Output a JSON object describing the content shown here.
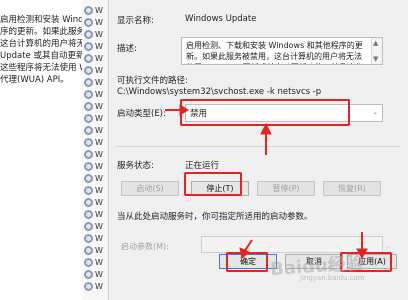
{
  "left_desc": {
    "lines": [
      "启用检测和安装 Windows 和",
      "序的更新。如果此服务被禁",
      "这台计算机的用户将无法使用",
      "Update 或其自动更新功能，",
      "这些程序将无法使用 Windows",
      "代理(WUA) API。"
    ]
  },
  "services_list": {
    "rows": [
      "W",
      "W",
      "W",
      "W",
      "W",
      "W",
      "W",
      "W",
      "W",
      "W",
      "W",
      "W",
      "W",
      "W",
      "W",
      "W",
      "W",
      "W",
      "W",
      "W",
      "W",
      "W",
      "W",
      "W"
    ]
  },
  "dialog": {
    "display_name_label": "显示名称:",
    "display_name_value": "Windows Update",
    "description_label": "描述:",
    "description_text": "启用检测、下载和安装 Windows 和其他程序的更新。如果此服务被禁用，这台计算机的用户将无法使用 Windows 更新或其自动更新功能，并且这些程序将无法",
    "exec_path_label": "可执行文件的路径:",
    "exec_path_value": "C:\\Windows\\system32\\svchost.exe -k netsvcs -p",
    "startup_type_label": "启动类型(E):",
    "startup_type_value": "禁用",
    "service_status_label": "服务状态:",
    "service_status_value": "正在运行",
    "buttons": {
      "start": "启动(S)",
      "stop": "停止(T)",
      "pause": "暂停(P)",
      "resume": "恢复(R)"
    },
    "start_hint": "当从此处启动服务时，你可指定所适用的启动参数。",
    "start_params_label": "启动参数(M):",
    "start_params_value": "",
    "footer": {
      "ok": "确定",
      "cancel": "取消",
      "apply": "应用(A)"
    }
  },
  "watermark": {
    "text": "Baidu经验",
    "sub": "jingyan.baidu.com"
  },
  "colors": {
    "annotation": "#e42323",
    "dialog_bg": "#f0f0f0",
    "default_button_border": "#3b7bd4"
  },
  "icons": [
    "gear-icon",
    "scroll-up-icon",
    "scroll-down-icon",
    "chevron-down-icon",
    "red-arrow-icon"
  ]
}
